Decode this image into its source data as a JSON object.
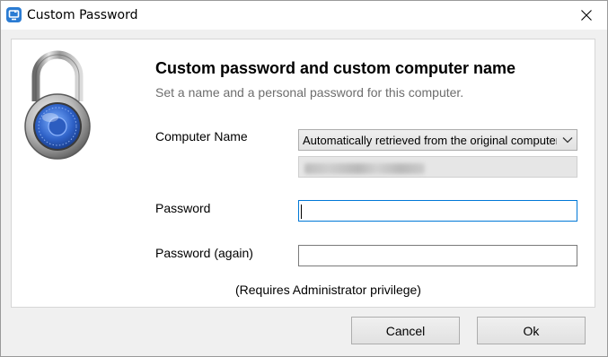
{
  "window": {
    "title": "Custom Password"
  },
  "header": {
    "title": "Custom password and custom computer name",
    "subtitle": "Set a name and a personal password for this computer."
  },
  "form": {
    "computer_name_label": "Computer Name",
    "computer_name_select_value": "Automatically retrieved from the original computer",
    "password_label": "Password",
    "password_value": "",
    "password_again_label": "Password (again)",
    "password_again_value": "",
    "note": "(Requires Administrator privilege)"
  },
  "buttons": {
    "cancel": "Cancel",
    "ok": "Ok"
  },
  "icons": {
    "app": "app-logo-icon",
    "close": "close-icon",
    "lock": "padlock-icon",
    "dropdown": "chevron-down-icon"
  },
  "colors": {
    "focus_border": "#0078d7",
    "subtitle": "#6d6d6d",
    "app_icon": "#2b7cd3"
  }
}
